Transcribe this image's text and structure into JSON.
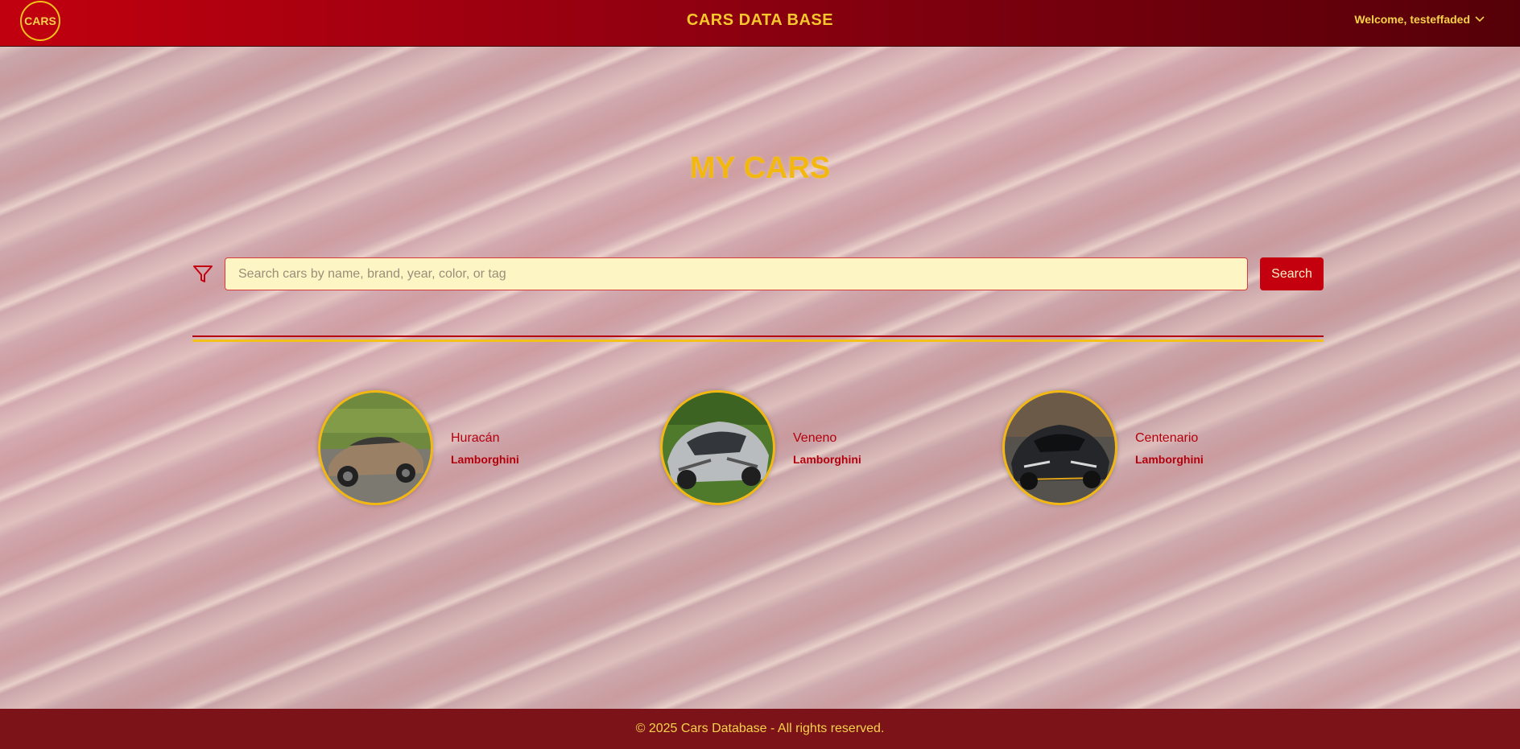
{
  "header": {
    "logo_text": "CARS",
    "title": "CARS DATA BASE",
    "user_greeting": "Welcome, testeffaded"
  },
  "main": {
    "heading": "MY CARS",
    "search": {
      "placeholder": "Search cars by name, brand, year, color, or tag",
      "value": "",
      "button_label": "Search"
    },
    "cars": [
      {
        "name": "Huracán",
        "brand": "Lamborghini"
      },
      {
        "name": "Veneno",
        "brand": "Lamborghini"
      },
      {
        "name": "Centenario",
        "brand": "Lamborghini"
      }
    ]
  },
  "footer": {
    "text": "© 2025 Cars Database - All rights reserved."
  },
  "colors": {
    "header_red": "#c1000f",
    "accent_gold": "#f2b811",
    "footer_red": "#7c1318",
    "search_bg": "#fdf6c4"
  },
  "icons": [
    "filter-icon",
    "chevron-down-icon"
  ]
}
